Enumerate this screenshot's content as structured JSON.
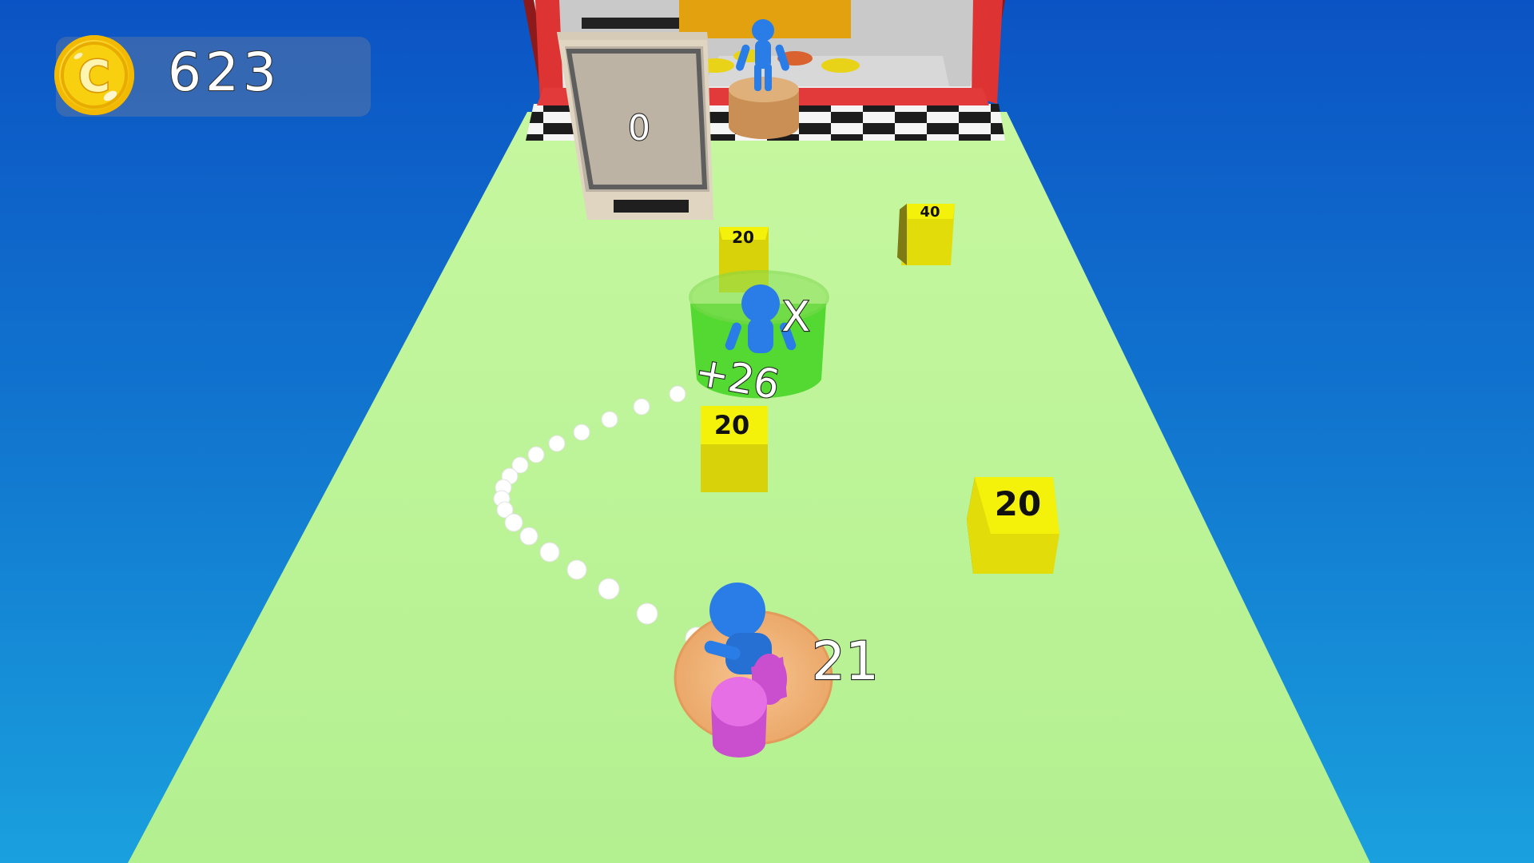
{
  "hud": {
    "coin_icon": "coin-icon",
    "coin_count": "623"
  },
  "finish": {
    "door_counter": "0"
  },
  "player": {
    "count": "21"
  },
  "pickup": {
    "bonus": "+26",
    "marker": "X"
  },
  "blocks": [
    {
      "value": "20"
    },
    {
      "value": "40"
    },
    {
      "value": "20"
    },
    {
      "value": "20"
    }
  ],
  "colors": {
    "track": "#bff59c",
    "block": "#f4f20a",
    "player": "#2a7de6",
    "sky": "#127ad0"
  }
}
